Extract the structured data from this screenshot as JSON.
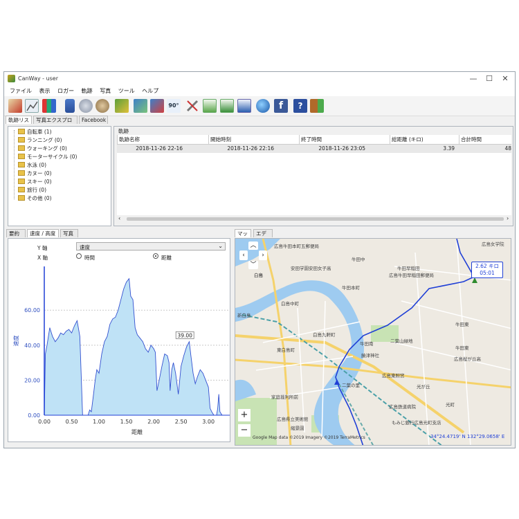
{
  "window": {
    "title": "CanWay - user",
    "controls": [
      "—",
      "☐",
      "✕"
    ]
  },
  "menu": [
    "ファイル",
    "表示",
    "ロガー",
    "軌跡",
    "写真",
    "ツール",
    "ヘルプ"
  ],
  "toolbar_icons": [
    "add-track-icon",
    "edit-track-icon",
    "graph-icon",
    "device-icon",
    "database-icon",
    "database-export-icon",
    "map-delete-icon",
    "photo-add-icon",
    "photo-remove-icon",
    "rotate-90-icon",
    "settings-icon",
    "gpx-export-icon",
    "kml-export-icon",
    "csv-export-icon",
    "google-earth-icon",
    "facebook-icon",
    "help-icon",
    "exit-icon"
  ],
  "top_tabs": [
    "軌跡リスト",
    "写真エクスプローラ",
    "Facebook"
  ],
  "categories": [
    "自転車 (1)",
    "ランニング (0)",
    "ウォーキング (0)",
    "モーターサイクル (0)",
    "水泳 (0)",
    "カヌー (0)",
    "スキー (0)",
    "旅行 (0)",
    "その他 (0)"
  ],
  "tracks": {
    "label": "軌跡",
    "columns": [
      "軌跡名称",
      "開始時刻",
      "終了時間",
      "総距離 (キロ)",
      "合計時間"
    ],
    "rows": [
      [
        "2018-11-26 22-16",
        "2018-11-26 22:16",
        "2018-11-26 23:05",
        "3.39",
        "48"
      ]
    ]
  },
  "bottom_tabs": [
    "要約",
    "速度 / 高度",
    "写真"
  ],
  "chart_controls": {
    "y_label": "Y 軸",
    "y_value": "速度",
    "x_label": "X 軸",
    "x_opt_time": "時間",
    "x_opt_distance": "距離",
    "x_selected": "距離"
  },
  "chart_data": {
    "type": "area",
    "xlabel": "距離",
    "ylabel": "速度",
    "xlim": [
      0,
      3.39
    ],
    "ylim": [
      0,
      85
    ],
    "yticks": [
      "0.00",
      "20.00",
      "40.00",
      "60.00"
    ],
    "xticks": [
      "0.00",
      "0.50",
      "1.00",
      "1.50",
      "2.00",
      "2.50",
      "3.00"
    ],
    "annotation": {
      "text": "39.00",
      "x": 2.57,
      "y": 39
    },
    "x": [
      0.0,
      0.02,
      0.05,
      0.1,
      0.15,
      0.2,
      0.25,
      0.3,
      0.35,
      0.4,
      0.45,
      0.5,
      0.55,
      0.6,
      0.65,
      0.7,
      0.75,
      0.8,
      0.83,
      0.86,
      0.9,
      0.93,
      0.96,
      1.0,
      1.05,
      1.1,
      1.15,
      1.2,
      1.25,
      1.3,
      1.35,
      1.4,
      1.45,
      1.5,
      1.55,
      1.58,
      1.62,
      1.66,
      1.7,
      1.75,
      1.8,
      1.85,
      1.9,
      1.95,
      2.0,
      2.03,
      2.06,
      2.1,
      2.15,
      2.2,
      2.25,
      2.28,
      2.3,
      2.33,
      2.36,
      2.4,
      2.45,
      2.5,
      2.55,
      2.6,
      2.65,
      2.68,
      2.72,
      2.76,
      2.8,
      2.85,
      2.9,
      2.95,
      3.0,
      3.03,
      3.06,
      3.1,
      3.15,
      3.17,
      3.19,
      3.21,
      3.25,
      3.3,
      3.35
    ],
    "y": [
      0,
      35,
      40,
      50,
      45,
      42,
      44,
      47,
      46,
      48,
      49,
      47,
      51,
      54,
      45,
      0,
      0,
      0,
      3,
      2,
      12,
      20,
      26,
      24,
      35,
      42,
      45,
      52,
      55,
      56,
      60,
      66,
      72,
      76,
      78,
      68,
      66,
      50,
      46,
      44,
      42,
      38,
      36,
      40,
      38,
      36,
      14,
      20,
      28,
      35,
      34,
      30,
      14,
      26,
      30,
      24,
      12,
      28,
      34,
      39,
      42,
      34,
      24,
      18,
      22,
      26,
      24,
      20,
      16,
      4,
      2,
      0,
      0,
      4,
      12,
      2,
      0,
      0,
      0
    ]
  },
  "map": {
    "tabs": [
      "マップ",
      "エディタ"
    ],
    "callout_distance": "2.62 キロ",
    "callout_time": "05:01",
    "attribution": "Google  Map data ©2019 Imagery ©2019 TerraMetrics",
    "coords": "34°24.4719' N 132°29.0658' E",
    "zoom_in": "+",
    "zoom_out": "−",
    "labels": [
      "広島牛田本町五郵便局",
      "牛田中",
      "安田学園安田女子高",
      "牛田早稲田",
      "広島牛田早稲田郵便局",
      "牛田本町",
      "白島",
      "白島中町",
      "白島九軒町",
      "牛田南",
      "二葉山緑地",
      "饒津神社",
      "東白島町",
      "広島東照宮",
      "光が丘",
      "広島鉄道病院",
      "二葉の里",
      "家庭裁判所前",
      "光町",
      "もみじ銀行広島光町支店",
      "広島県立美術館",
      "縮景園",
      "広島女学院",
      "広島桜が丘高",
      "牛田東",
      "牛田東",
      "白島",
      "新白島",
      "二葉の里",
      "中国電力",
      "大竹"
    ]
  },
  "colors": {
    "accent": "#1f3fd6",
    "area_fill": "#bfe2f6",
    "route": "#1f3fd6",
    "map_bg": "#eeeae2",
    "water": "#9ecbf0",
    "green": "#c8e3b4",
    "road_yellow": "#f5d26b"
  }
}
